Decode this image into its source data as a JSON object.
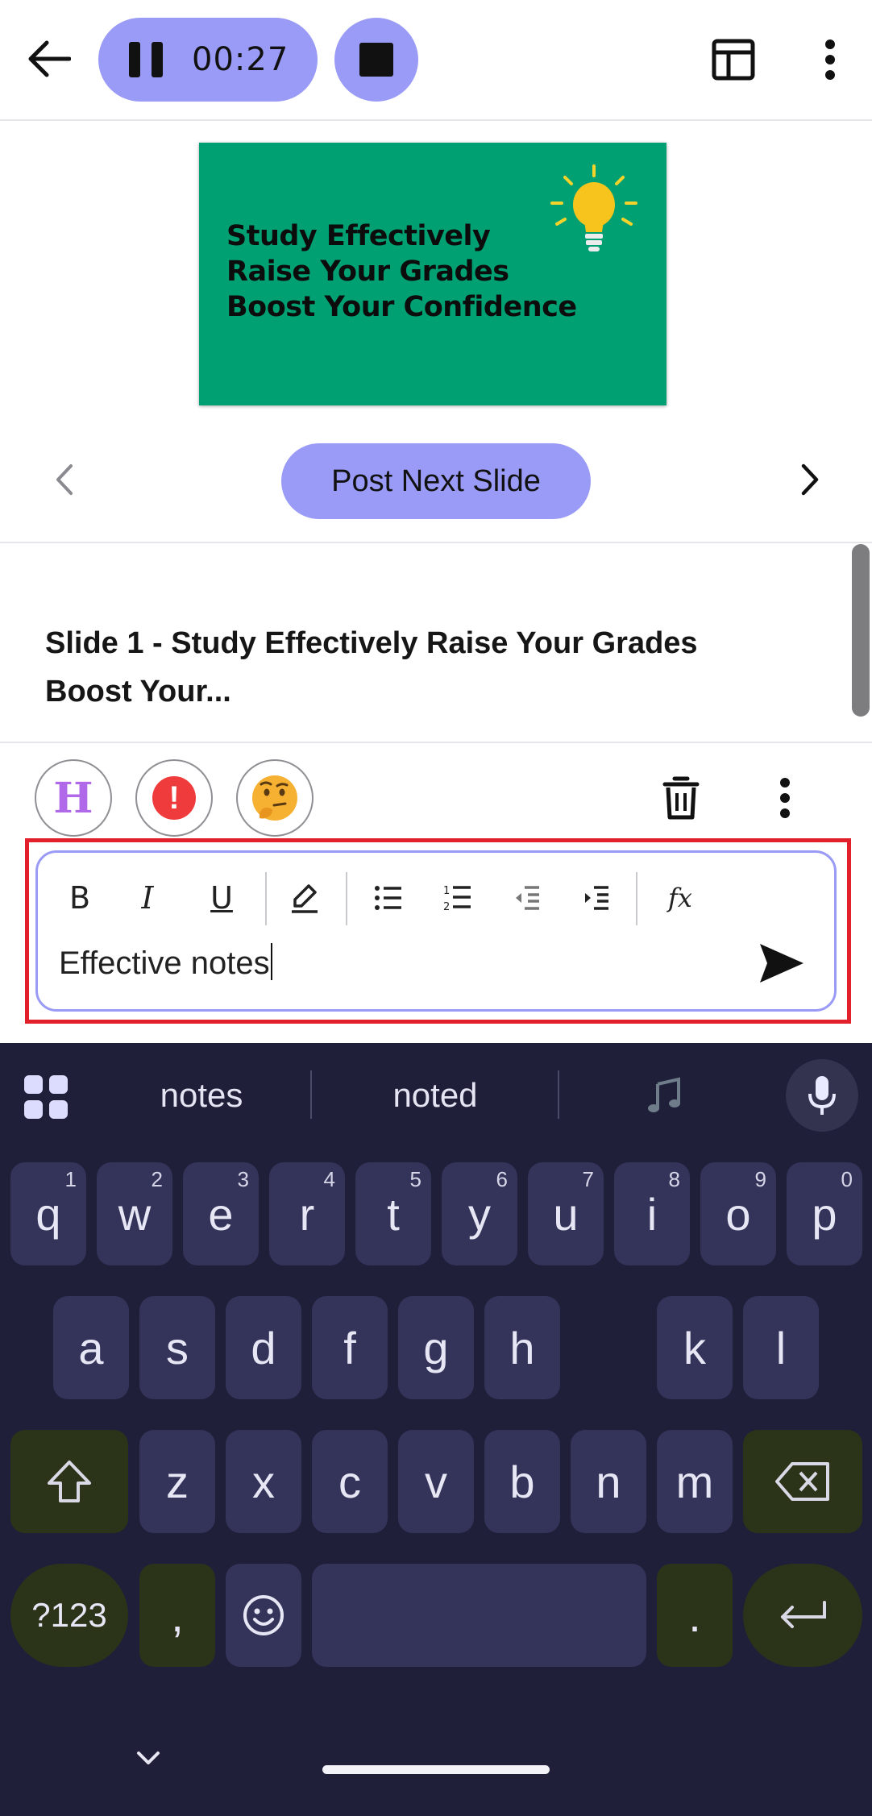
{
  "topbar": {
    "recording_time": "00:27",
    "icons": {
      "back": "arrow-left-icon",
      "pause": "pause-icon",
      "stop": "stop-icon",
      "layout": "layout-icon",
      "more": "more-vertical-icon"
    }
  },
  "slide": {
    "lines": [
      "Study Effectively",
      "Raise Your Grades",
      "Boost Your Confidence"
    ],
    "background_color": "#00a073"
  },
  "nav": {
    "post_next_label": "Post Next Slide",
    "accent_color": "#9a9bf6"
  },
  "slide_title": "Slide 1 - Study Effectively Raise Your Grades Boost Your...",
  "reactions": {
    "h_label": "H",
    "exclamation_label": "!",
    "thinking_emoji": "🤔"
  },
  "editor": {
    "tools": [
      "B",
      "I",
      "U",
      "highlighter-icon",
      "bullet-list-icon",
      "numbered-list-icon",
      "outdent-icon",
      "indent-icon",
      "formula-icon"
    ],
    "formula_label": "fx",
    "value": "Effective notes",
    "highlight_color": "#e2202c"
  },
  "keyboard": {
    "suggestions": [
      "notes",
      "noted"
    ],
    "row1": [
      {
        "key": "q",
        "hint": "1"
      },
      {
        "key": "w",
        "hint": "2"
      },
      {
        "key": "e",
        "hint": "3"
      },
      {
        "key": "r",
        "hint": "4"
      },
      {
        "key": "t",
        "hint": "5"
      },
      {
        "key": "y",
        "hint": "6"
      },
      {
        "key": "u",
        "hint": "7"
      },
      {
        "key": "i",
        "hint": "8"
      },
      {
        "key": "o",
        "hint": "9"
      },
      {
        "key": "p",
        "hint": "0"
      }
    ],
    "row2": [
      "a",
      "s",
      "d",
      "f",
      "g",
      "h",
      "k",
      "l"
    ],
    "row3": [
      "z",
      "x",
      "c",
      "v",
      "b",
      "n",
      "m"
    ],
    "symbols_label": "?123",
    "comma": ",",
    "period": "."
  }
}
